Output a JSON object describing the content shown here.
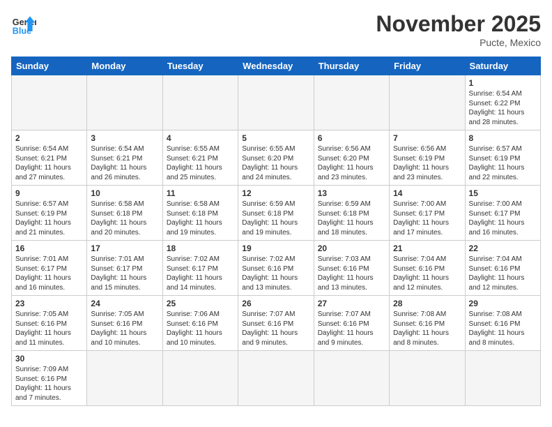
{
  "header": {
    "logo_general": "General",
    "logo_blue": "Blue",
    "month_year": "November 2025",
    "location": "Pucte, Mexico"
  },
  "weekdays": [
    "Sunday",
    "Monday",
    "Tuesday",
    "Wednesday",
    "Thursday",
    "Friday",
    "Saturday"
  ],
  "weeks": [
    [
      {
        "day": "",
        "info": ""
      },
      {
        "day": "",
        "info": ""
      },
      {
        "day": "",
        "info": ""
      },
      {
        "day": "",
        "info": ""
      },
      {
        "day": "",
        "info": ""
      },
      {
        "day": "",
        "info": ""
      },
      {
        "day": "1",
        "info": "Sunrise: 6:54 AM\nSunset: 6:22 PM\nDaylight: 11 hours\nand 28 minutes."
      }
    ],
    [
      {
        "day": "2",
        "info": "Sunrise: 6:54 AM\nSunset: 6:21 PM\nDaylight: 11 hours\nand 27 minutes."
      },
      {
        "day": "3",
        "info": "Sunrise: 6:54 AM\nSunset: 6:21 PM\nDaylight: 11 hours\nand 26 minutes."
      },
      {
        "day": "4",
        "info": "Sunrise: 6:55 AM\nSunset: 6:21 PM\nDaylight: 11 hours\nand 25 minutes."
      },
      {
        "day": "5",
        "info": "Sunrise: 6:55 AM\nSunset: 6:20 PM\nDaylight: 11 hours\nand 24 minutes."
      },
      {
        "day": "6",
        "info": "Sunrise: 6:56 AM\nSunset: 6:20 PM\nDaylight: 11 hours\nand 23 minutes."
      },
      {
        "day": "7",
        "info": "Sunrise: 6:56 AM\nSunset: 6:19 PM\nDaylight: 11 hours\nand 23 minutes."
      },
      {
        "day": "8",
        "info": "Sunrise: 6:57 AM\nSunset: 6:19 PM\nDaylight: 11 hours\nand 22 minutes."
      }
    ],
    [
      {
        "day": "9",
        "info": "Sunrise: 6:57 AM\nSunset: 6:19 PM\nDaylight: 11 hours\nand 21 minutes."
      },
      {
        "day": "10",
        "info": "Sunrise: 6:58 AM\nSunset: 6:18 PM\nDaylight: 11 hours\nand 20 minutes."
      },
      {
        "day": "11",
        "info": "Sunrise: 6:58 AM\nSunset: 6:18 PM\nDaylight: 11 hours\nand 19 minutes."
      },
      {
        "day": "12",
        "info": "Sunrise: 6:59 AM\nSunset: 6:18 PM\nDaylight: 11 hours\nand 19 minutes."
      },
      {
        "day": "13",
        "info": "Sunrise: 6:59 AM\nSunset: 6:18 PM\nDaylight: 11 hours\nand 18 minutes."
      },
      {
        "day": "14",
        "info": "Sunrise: 7:00 AM\nSunset: 6:17 PM\nDaylight: 11 hours\nand 17 minutes."
      },
      {
        "day": "15",
        "info": "Sunrise: 7:00 AM\nSunset: 6:17 PM\nDaylight: 11 hours\nand 16 minutes."
      }
    ],
    [
      {
        "day": "16",
        "info": "Sunrise: 7:01 AM\nSunset: 6:17 PM\nDaylight: 11 hours\nand 16 minutes."
      },
      {
        "day": "17",
        "info": "Sunrise: 7:01 AM\nSunset: 6:17 PM\nDaylight: 11 hours\nand 15 minutes."
      },
      {
        "day": "18",
        "info": "Sunrise: 7:02 AM\nSunset: 6:17 PM\nDaylight: 11 hours\nand 14 minutes."
      },
      {
        "day": "19",
        "info": "Sunrise: 7:02 AM\nSunset: 6:16 PM\nDaylight: 11 hours\nand 13 minutes."
      },
      {
        "day": "20",
        "info": "Sunrise: 7:03 AM\nSunset: 6:16 PM\nDaylight: 11 hours\nand 13 minutes."
      },
      {
        "day": "21",
        "info": "Sunrise: 7:04 AM\nSunset: 6:16 PM\nDaylight: 11 hours\nand 12 minutes."
      },
      {
        "day": "22",
        "info": "Sunrise: 7:04 AM\nSunset: 6:16 PM\nDaylight: 11 hours\nand 12 minutes."
      }
    ],
    [
      {
        "day": "23",
        "info": "Sunrise: 7:05 AM\nSunset: 6:16 PM\nDaylight: 11 hours\nand 11 minutes."
      },
      {
        "day": "24",
        "info": "Sunrise: 7:05 AM\nSunset: 6:16 PM\nDaylight: 11 hours\nand 10 minutes."
      },
      {
        "day": "25",
        "info": "Sunrise: 7:06 AM\nSunset: 6:16 PM\nDaylight: 11 hours\nand 10 minutes."
      },
      {
        "day": "26",
        "info": "Sunrise: 7:07 AM\nSunset: 6:16 PM\nDaylight: 11 hours\nand 9 minutes."
      },
      {
        "day": "27",
        "info": "Sunrise: 7:07 AM\nSunset: 6:16 PM\nDaylight: 11 hours\nand 9 minutes."
      },
      {
        "day": "28",
        "info": "Sunrise: 7:08 AM\nSunset: 6:16 PM\nDaylight: 11 hours\nand 8 minutes."
      },
      {
        "day": "29",
        "info": "Sunrise: 7:08 AM\nSunset: 6:16 PM\nDaylight: 11 hours\nand 8 minutes."
      }
    ],
    [
      {
        "day": "30",
        "info": "Sunrise: 7:09 AM\nSunset: 6:16 PM\nDaylight: 11 hours\nand 7 minutes."
      },
      {
        "day": "",
        "info": ""
      },
      {
        "day": "",
        "info": ""
      },
      {
        "day": "",
        "info": ""
      },
      {
        "day": "",
        "info": ""
      },
      {
        "day": "",
        "info": ""
      },
      {
        "day": "",
        "info": ""
      }
    ]
  ]
}
